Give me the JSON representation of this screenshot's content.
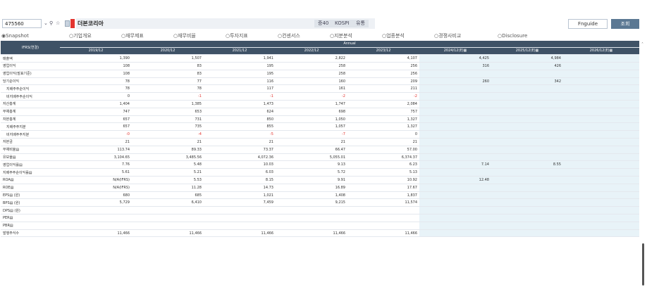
{
  "header": {
    "code": "475560",
    "company": "더본코리아",
    "tags": [
      "증40",
      "KOSPI",
      "유통"
    ],
    "fnguide_label": "Fnguide",
    "search_label": "조회"
  },
  "tabs": [
    {
      "label": "◉Snapshot"
    },
    {
      "label": "○기업개요"
    },
    {
      "label": "○재무제표"
    },
    {
      "label": "○재무비율"
    },
    {
      "label": "○투자지표"
    },
    {
      "label": "○컨센서스"
    },
    {
      "label": "○지분분석"
    },
    {
      "label": "○업종분석"
    },
    {
      "label": "○경쟁사비교"
    },
    {
      "label": "○Disclosure"
    }
  ],
  "table": {
    "corner_label": "IFRS(연결)",
    "group_label": "Annual",
    "columns": [
      "2019/12",
      "2020/12",
      "2021/12",
      "2022/12",
      "2023/12",
      "2024/12(E)▦",
      "2025/12(E)▦",
      "2026/12(E)▦"
    ],
    "rows": [
      {
        "label": "매출액",
        "values": [
          "1,390",
          "1,507",
          "1,941",
          "2,822",
          "4,107",
          "4,425",
          "4,984",
          ""
        ]
      },
      {
        "label": "영업이익",
        "values": [
          "108",
          "83",
          "195",
          "258",
          "256",
          "316",
          "426",
          ""
        ]
      },
      {
        "label": "영업이익(발표기준)",
        "values": [
          "108",
          "83",
          "195",
          "258",
          "256",
          "",
          "",
          ""
        ]
      },
      {
        "label": "당기순이익",
        "values": [
          "78",
          "77",
          "116",
          "160",
          "209",
          "260",
          "342",
          ""
        ]
      },
      {
        "label": "지배주주순이익",
        "sub": true,
        "values": [
          "78",
          "78",
          "117",
          "161",
          "211",
          "",
          "",
          ""
        ]
      },
      {
        "label": "비지배주주순이익",
        "sub": true,
        "values": [
          "0",
          "-1",
          "-1",
          "-2",
          "-2",
          "",
          "",
          ""
        ]
      },
      {
        "label": "자산총계",
        "values": [
          "1,404",
          "1,385",
          "1,473",
          "1,747",
          "2,084",
          "",
          "",
          ""
        ]
      },
      {
        "label": "부채총계",
        "values": [
          "747",
          "653",
          "624",
          "698",
          "757",
          "",
          "",
          ""
        ]
      },
      {
        "label": "자본총계",
        "values": [
          "657",
          "731",
          "850",
          "1,050",
          "1,327",
          "",
          "",
          ""
        ]
      },
      {
        "label": "지배주주지분",
        "sub": true,
        "values": [
          "657",
          "735",
          "855",
          "1,057",
          "1,327",
          "",
          "",
          ""
        ]
      },
      {
        "label": "비지배주주지분",
        "sub": true,
        "values": [
          "-0",
          "-4",
          "-5",
          "-7",
          "0",
          "",
          "",
          ""
        ]
      },
      {
        "label": "자본금",
        "values": [
          "21",
          "21",
          "21",
          "21",
          "21",
          "",
          "",
          ""
        ]
      },
      {
        "label": "부채비율▤",
        "values": [
          "113.74",
          "89.33",
          "73.37",
          "66.47",
          "57.00",
          "",
          "",
          ""
        ]
      },
      {
        "label": "유보율▤",
        "values": [
          "3,104.65",
          "3,485.56",
          "4,072.36",
          "5,055.01",
          "6,374.37",
          "",
          "",
          ""
        ]
      },
      {
        "label": "영업이익률▤",
        "values": [
          "7.76",
          "5.48",
          "10.03",
          "9.13",
          "6.23",
          "7.14",
          "8.55",
          ""
        ]
      },
      {
        "label": "지배주주순이익률▤",
        "values": [
          "5.61",
          "5.21",
          "6.03",
          "5.72",
          "5.13",
          "",
          "",
          ""
        ]
      },
      {
        "label": "ROA▤",
        "values": [
          "N/A(IFRS)",
          "5.53",
          "8.15",
          "9.91",
          "10.92",
          "12.48",
          "",
          ""
        ]
      },
      {
        "label": "ROE▤",
        "values": [
          "N/A(IFRS)",
          "11.28",
          "14.73",
          "16.89",
          "17.67",
          "",
          "",
          ""
        ]
      },
      {
        "label": "EPS▤  (원)",
        "values": [
          "680",
          "685",
          "1,021",
          "1,408",
          "1,837",
          "",
          "",
          ""
        ]
      },
      {
        "label": "BPS▤  (원)",
        "values": [
          "5,729",
          "6,410",
          "7,459",
          "9,215",
          "11,574",
          "",
          "",
          ""
        ]
      },
      {
        "label": "DPS▤  (원)",
        "values": [
          "",
          "",
          "",
          "",
          "",
          "",
          "",
          ""
        ]
      },
      {
        "label": "PER▤",
        "values": [
          "",
          "",
          "",
          "",
          "",
          "",
          "",
          ""
        ]
      },
      {
        "label": "PBR▤",
        "values": [
          "",
          "",
          "",
          "",
          "",
          "",
          "",
          ""
        ]
      },
      {
        "label": "발행주식수",
        "values": [
          "11,466",
          "11,466",
          "11,466",
          "11,466",
          "11,466",
          "",
          "",
          ""
        ]
      }
    ]
  },
  "colors": {
    "header_bg": "#3f5266",
    "estimate_bg": "#e8f3f8",
    "negative": "#e3342f",
    "search_btn": "#5b7893"
  },
  "icons": {
    "search": "search-icon",
    "star": "star-icon",
    "dropdown": "chevron-down-icon"
  }
}
